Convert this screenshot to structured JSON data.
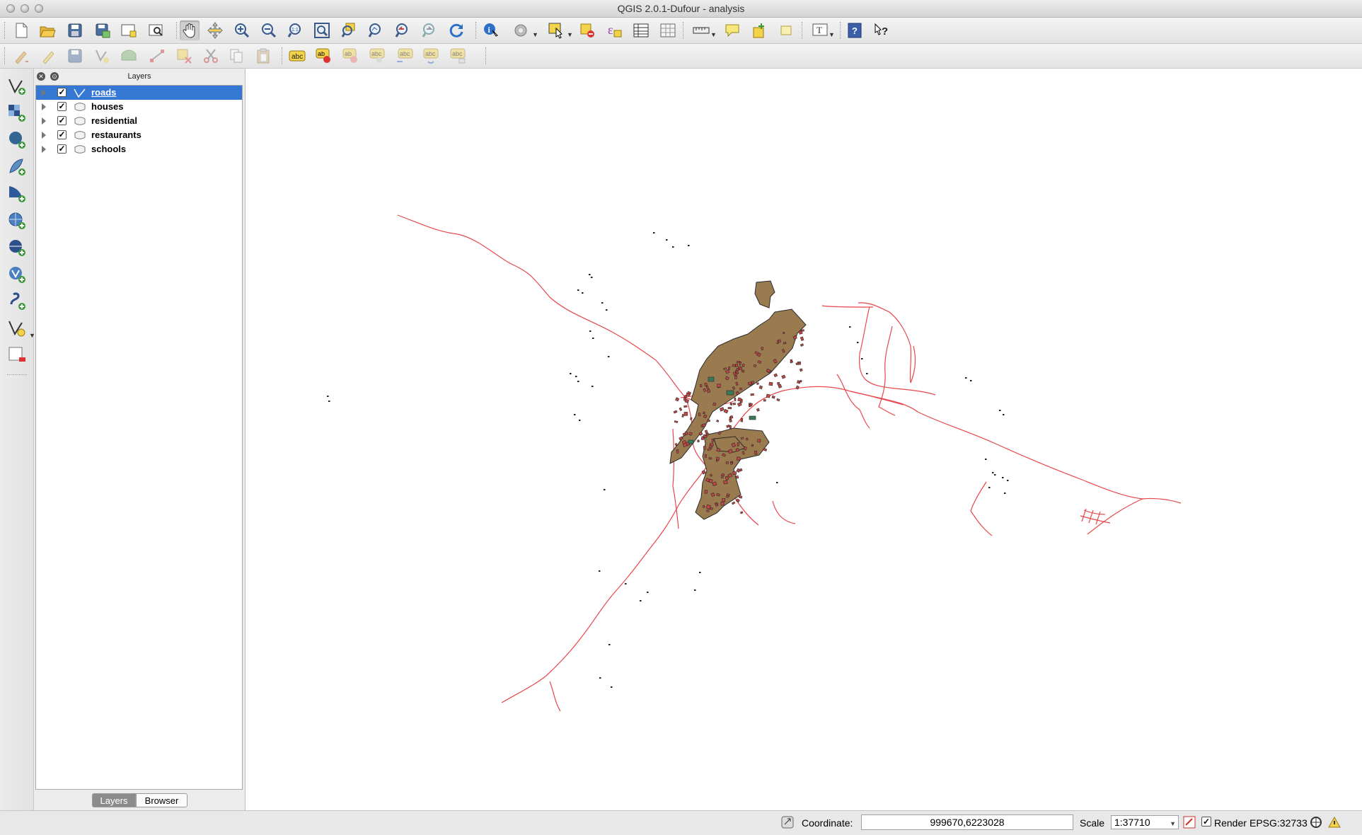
{
  "window": {
    "title": "QGIS 2.0.1-Dufour - analysis"
  },
  "toolbar_main": {
    "buttons": [
      {
        "name": "new-project-icon"
      },
      {
        "name": "open-project-icon"
      },
      {
        "name": "save-project-icon"
      },
      {
        "name": "save-as-icon"
      },
      {
        "name": "new-print-composer-icon"
      },
      {
        "name": "composer-manager-icon"
      },
      {
        "name": "pan-icon",
        "active": true
      },
      {
        "name": "pan-to-selection-icon"
      },
      {
        "name": "zoom-in-icon"
      },
      {
        "name": "zoom-out-icon"
      },
      {
        "name": "zoom-actual-icon"
      },
      {
        "name": "zoom-full-icon"
      },
      {
        "name": "zoom-to-selection-icon"
      },
      {
        "name": "zoom-to-layer-icon"
      },
      {
        "name": "zoom-last-icon"
      },
      {
        "name": "zoom-next-icon"
      },
      {
        "name": "refresh-icon"
      },
      {
        "name": "identify-icon"
      },
      {
        "name": "run-action-icon"
      },
      {
        "name": "select-features-icon"
      },
      {
        "name": "deselect-icon"
      },
      {
        "name": "expression-select-icon"
      },
      {
        "name": "attribute-table-icon"
      },
      {
        "name": "field-calculator-icon"
      },
      {
        "name": "measure-icon"
      },
      {
        "name": "map-tips-icon"
      },
      {
        "name": "new-bookmark-icon"
      },
      {
        "name": "show-bookmarks-icon"
      },
      {
        "name": "text-annotation-icon"
      },
      {
        "name": "help-contents-icon"
      },
      {
        "name": "whats-this-icon"
      }
    ]
  },
  "toolbar_edit": {
    "buttons": [
      {
        "name": "current-edits-icon"
      },
      {
        "name": "toggle-editing-icon"
      },
      {
        "name": "save-edits-icon"
      },
      {
        "name": "add-feature-icon"
      },
      {
        "name": "move-feature-icon"
      },
      {
        "name": "node-tool-icon"
      },
      {
        "name": "delete-selected-icon"
      },
      {
        "name": "cut-features-icon"
      },
      {
        "name": "copy-features-icon"
      },
      {
        "name": "paste-features-icon"
      },
      {
        "name": "label-tool-icon"
      },
      {
        "name": "pin-labels-icon"
      },
      {
        "name": "highlight-pinned-labels-icon"
      },
      {
        "name": "show-hide-labels-icon"
      },
      {
        "name": "move-label-icon"
      },
      {
        "name": "rotate-label-icon"
      },
      {
        "name": "change-label-icon"
      }
    ]
  },
  "left_toolbar": {
    "buttons": [
      {
        "name": "add-vector-layer-icon"
      },
      {
        "name": "add-raster-layer-icon"
      },
      {
        "name": "add-postgis-layer-icon"
      },
      {
        "name": "add-spatialite-layer-icon"
      },
      {
        "name": "add-mssql-layer-icon"
      },
      {
        "name": "add-wms-layer-icon"
      },
      {
        "name": "add-wcs-layer-icon"
      },
      {
        "name": "add-wfs-layer-icon"
      },
      {
        "name": "add-delimited-text-layer-icon"
      },
      {
        "name": "new-shapefile-layer-icon"
      },
      {
        "name": "remove-layer-icon"
      }
    ]
  },
  "layers_panel": {
    "title": "Layers",
    "layers": [
      {
        "name": "roads",
        "checked": true,
        "selected": true,
        "geometry": "line"
      },
      {
        "name": "houses",
        "checked": true,
        "selected": false,
        "geometry": "polygon"
      },
      {
        "name": "residential",
        "checked": true,
        "selected": false,
        "geometry": "polygon"
      },
      {
        "name": "restaurants",
        "checked": true,
        "selected": false,
        "geometry": "polygon"
      },
      {
        "name": "schools",
        "checked": true,
        "selected": false,
        "geometry": "polygon"
      }
    ],
    "tabs": [
      {
        "label": "Layers",
        "active": true
      },
      {
        "label": "Browser",
        "active": false
      }
    ]
  },
  "map_colors": {
    "roads": "#e8474b",
    "residential": "#9a7a4f",
    "houses": "#c44545",
    "schools": "#3a7a5a",
    "outline": "#2a2a2a"
  },
  "status_bar": {
    "coordinate_label": "Coordinate:",
    "coordinate_value": "999670,6223028",
    "scale_label": "Scale",
    "scale_value": "1:37710",
    "render_label": "Render",
    "render_checked": true,
    "crs": "EPSG:32733"
  }
}
